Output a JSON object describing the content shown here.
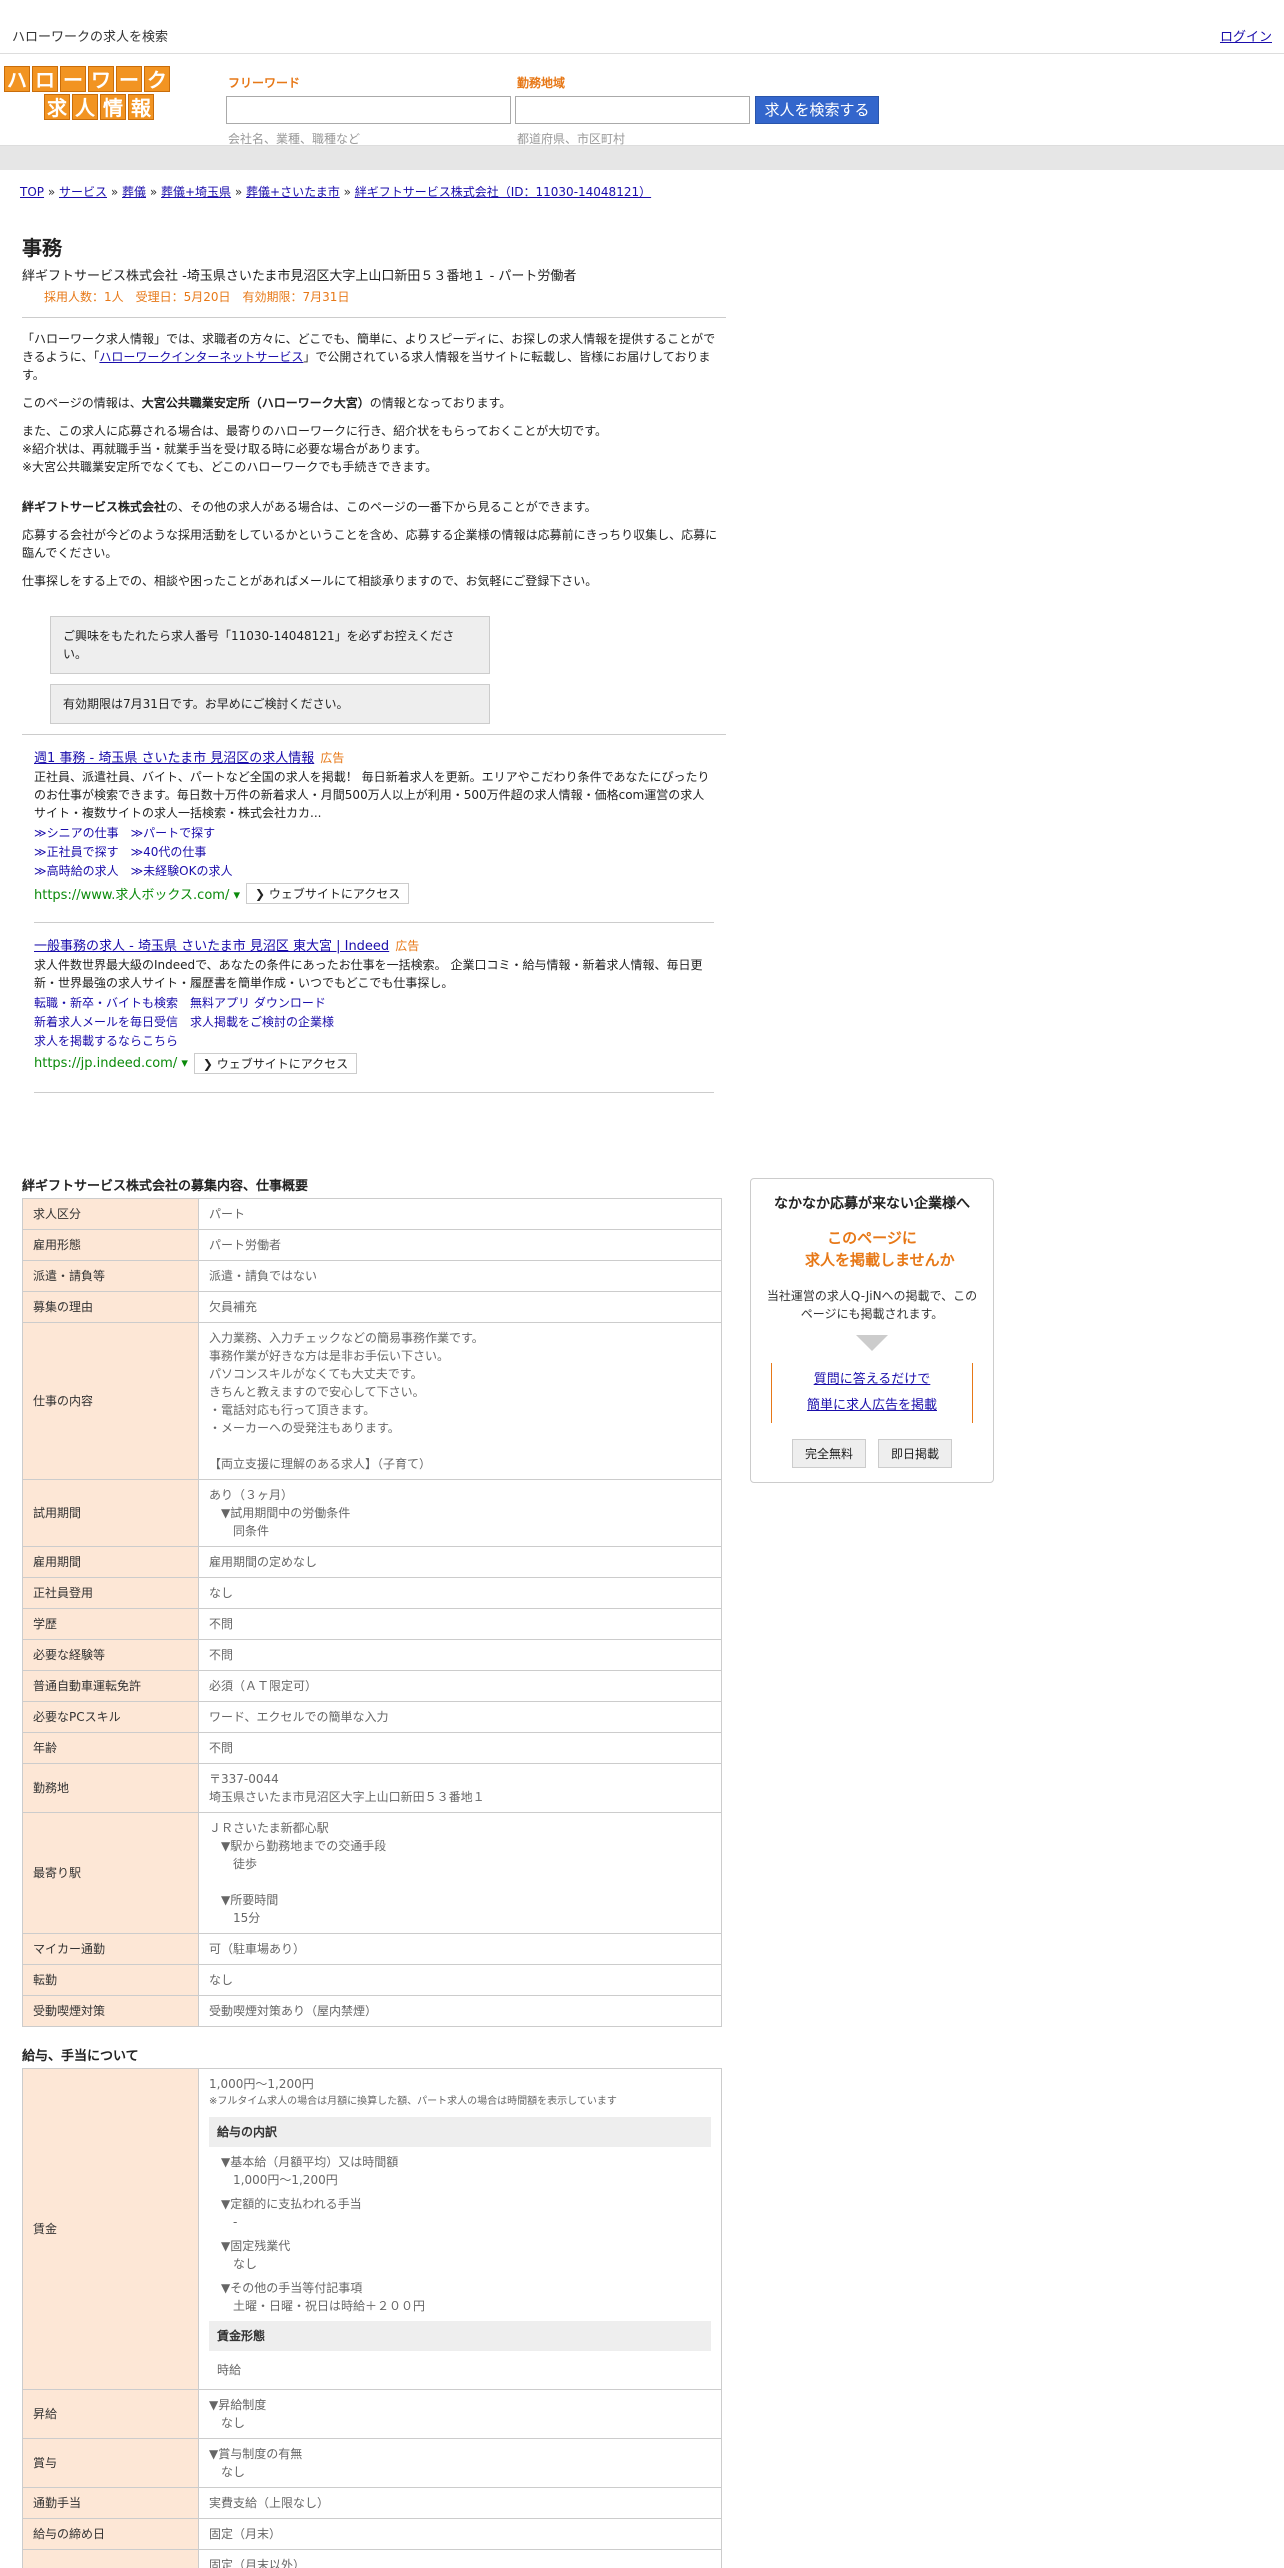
{
  "header": {
    "title": "ハローワークの求人を検索",
    "login": "ログイン"
  },
  "logo": {
    "row1": [
      "ハ",
      "ロ",
      "ー",
      "ワ",
      "ー",
      "ク"
    ],
    "row2": [
      "求",
      "人",
      "情",
      "報"
    ]
  },
  "search": {
    "free_label": "フリーワード",
    "free_hint": "会社名、業種、職種など",
    "area_label": "勤務地域",
    "area_hint": "都道府県、市区町村",
    "button": "求人を検索する"
  },
  "breadcrumb": {
    "items": [
      "TOP",
      "サービス",
      "葬儀",
      "葬儀+埼玉県",
      "葬儀+さいたま市",
      "絆ギフトサービス株式会社（ID：11030-14048121）"
    ],
    "sep": " » "
  },
  "job": {
    "title": "事務",
    "company_line": "絆ギフトサービス株式会社 -埼玉県さいたま市見沼区大字上山口新田５３番地１ - パート労働者",
    "meta": "採用人数：1人　受理日：5月20日　有効期限：7月31日"
  },
  "intro": {
    "p1a": "「ハローワーク求人情報」では、求職者の方々に、どこでも、簡単に、よりスピーディに、お探しの求人情報を提供することができるように、「",
    "p1link": "ハローワークインターネットサービス",
    "p1b": "」で公開されている求人情報を当サイトに転載し、皆様にお届けしております。",
    "p2a": "このページの情報は、",
    "p2b": "大宮公共職業安定所（ハローワーク大宮）",
    "p2c": "の情報となっております。",
    "p3l1": "また、この求人に応募される場合は、最寄りのハローワークに行き、紹介状をもらっておくことが大切です。",
    "p3l2": "※紹介状は、再就職手当・就業手当を受け取る時に必要な場合があります。",
    "p3l3": "※大宮公共職業安定所でなくても、どこのハローワークでも手続きできます。",
    "p4a": "絆ギフトサービス株式会社",
    "p4b": "の、その他の求人がある場合は、このページの一番下から見ることができます。",
    "p5": "応募する会社が今どのような採用活動をしているかということを含め、応募する企業様の情報は応募前にきっちり収集し、応募に臨んでください。",
    "p6": "仕事探しをする上での、相談や困ったことがあればメールにて相談承りますので、お気軽にご登録下さい。",
    "notice1": "ご興味をもたれたら求人番号「11030-14048121」を必ずお控えください。",
    "notice2": "有効期限は7月31日です。お早めにご検討ください。"
  },
  "ads": [
    {
      "title": "週1 事務 - 埼玉県 さいたま市 見沼区の求人情報",
      "tag": "広告",
      "desc": "正社員、派遣社員、バイト、パートなど全国の求人を掲載！ 毎日新着求人を更新。エリアやこだわり条件であなたにぴったりのお仕事が検索できます。毎日数十万件の新着求人・月間500万人以上が利用・500万件超の求人情報・価格com運営の求人サイト・複数サイトの求人一括検索・株式会社カカ...",
      "links": [
        "≫シニアの仕事　≫パートで探す",
        "≫正社員で探す　≫40代の仕事",
        "≫高時給の求人　≫未経験OKの求人"
      ],
      "url": "https://www.求人ボックス.com/",
      "visit": "❯ ウェブサイトにアクセス"
    },
    {
      "title": "一般事務の求人 - 埼玉県 さいたま市 見沼区 東大宮 | Indeed",
      "tag": "広告",
      "desc": "求人件数世界最大級のIndeedで、あなたの条件にあったお仕事を一括検索。 企業口コミ・給与情報・新着求人情報、毎日更新・世界最強の求人サイト・履歴書を簡単作成・いつでもどこでも仕事探し。",
      "links": [
        "転職・新卒・バイトも検索　無料アプリ ダウンロード",
        "新着求人メールを毎日受信　求人掲載をご検討の企業様",
        "求人を掲載するならこちら"
      ],
      "url": "https://jp.indeed.com/",
      "visit": "❯ ウェブサイトにアクセス"
    }
  ],
  "details": {
    "title": "絆ギフトサービス株式会社の募集内容、仕事概要",
    "rows": [
      {
        "k": "求人区分",
        "v": "パート"
      },
      {
        "k": "雇用形態",
        "v": "パート労働者"
      },
      {
        "k": "派遣・請負等",
        "v": "派遣・請負ではない"
      },
      {
        "k": "募集の理由",
        "v": "欠員補充"
      },
      {
        "k": "仕事の内容",
        "v": "入力業務、入力チェックなどの簡易事務作業です。\n事務作業が好きな方は是非お手伝い下さい。\nパソコンスキルがなくても大丈夫です。\nきちんと教えますので安心して下さい。\n・電話対応も行って頂きます。\n・メーカーへの受発注もあります。\n\n【両立支援に理解のある求人】（子育て）"
      },
      {
        "k": "試用期間",
        "v": "あり（３ヶ月）\n　▼試用期間中の労働条件\n　　同条件"
      },
      {
        "k": "雇用期間",
        "v": "雇用期間の定めなし"
      },
      {
        "k": "正社員登用",
        "v": "なし"
      },
      {
        "k": "学歴",
        "v": "不問"
      },
      {
        "k": "必要な経験等",
        "v": "不問"
      },
      {
        "k": "普通自動車運転免許",
        "v": "必須（ＡＴ限定可）"
      },
      {
        "k": "必要なPCスキル",
        "v": "ワード、エクセルでの簡単な入力"
      },
      {
        "k": "年齢",
        "v": "不問"
      },
      {
        "k": "勤務地",
        "v": "〒337-0044\n埼玉県さいたま市見沼区大字上山口新田５３番地１"
      },
      {
        "k": "最寄り駅",
        "v": "ＪＲさいたま新都心駅\n　▼駅から勤務地までの交通手段\n　　徒歩\n\n　▼所要時間\n　　15分"
      },
      {
        "k": "マイカー通勤",
        "v": "可（駐車場あり）"
      },
      {
        "k": "転勤",
        "v": "なし"
      },
      {
        "k": "受動喫煙対策",
        "v": "受動喫煙対策あり（屋内禁煙）"
      }
    ]
  },
  "salary": {
    "title": "給与、手当について",
    "wage_key": "賃金",
    "wage_main": "1,000円〜1,200円",
    "wage_note": "※フルタイム求人の場合は月額に換算した額、パート求人の場合は時間額を表示しています",
    "breakdown_head": "給与の内訳",
    "breakdown": [
      "▼基本給（月額平均）又は時間額\n　1,000円〜1,200円",
      "▼定額的に支払われる手当\n　-",
      "▼固定残業代\n　なし",
      "▼その他の手当等付記事項\n　土曜・日曜・祝日は時給＋２００円"
    ],
    "form_head": "賃金形態",
    "form_value": "時給",
    "rows": [
      {
        "k": "昇給",
        "v": "▼昇給制度\n　なし"
      },
      {
        "k": "賞与",
        "v": "▼賞与制度の有無\n　なし"
      },
      {
        "k": "通勤手当",
        "v": "実費支給（上限なし）"
      },
      {
        "k": "給与の締め日",
        "v": "固定（月末）"
      },
      {
        "k": "",
        "v": "固定（月末以外）"
      }
    ]
  },
  "side": {
    "head": "なかなか応募が来ない企業様へ",
    "catch1": "このページに",
    "catch2": "求人を掲載しませんか",
    "desc": "当社運営の求人Q-JiNへの掲載で、このページにも掲載されます。",
    "link1": "質問に答えるだけで",
    "link2": "簡単に求人広告を掲載",
    "btn1": "完全無料",
    "btn2": "即日掲載"
  }
}
